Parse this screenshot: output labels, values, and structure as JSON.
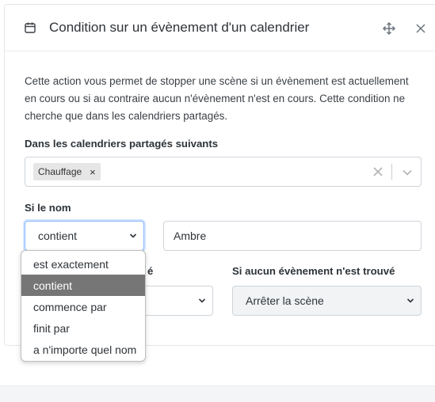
{
  "header": {
    "title": "Condition sur un évènement d'un calendrier",
    "icon": "calendar-icon"
  },
  "description": "Cette action vous permet de stopper une scène si un évènement est actuellement en cours ou si au contraire aucun n'évènement n'est en cours. Cette condition ne cherche que dans les calendriers partagés.",
  "calendars": {
    "label": "Dans les calendriers partagés suivants",
    "selected": [
      "Chauffage"
    ],
    "chip_remove": "×"
  },
  "name_filter": {
    "label": "Si le nom",
    "operator_value": "contient",
    "text_value": "Ambre",
    "options": [
      "est exactement",
      "contient",
      "commence par",
      "finit par",
      "a n'importe quel nom"
    ],
    "selected_index": 1
  },
  "found": {
    "label_partial": "é"
  },
  "not_found": {
    "label": "Si aucun évènement n'est trouvé",
    "value": "Arrêter la scène"
  }
}
